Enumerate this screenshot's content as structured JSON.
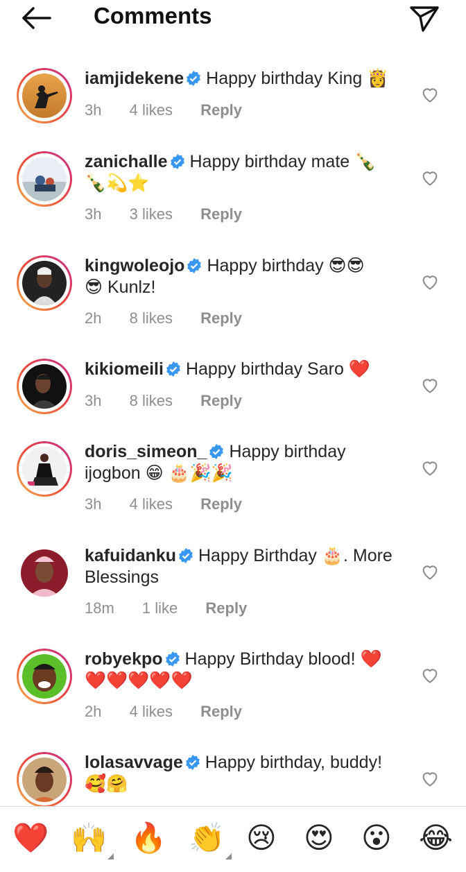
{
  "header": {
    "title": "Comments",
    "back_icon": "arrow-left-icon",
    "send_icon": "paper-plane-icon"
  },
  "comments": [
    {
      "username": "iamjidekene",
      "verified": true,
      "text": "Happy birthday King 👸",
      "extra": "",
      "time": "3h",
      "likes": "4 likes",
      "reply": "Reply",
      "story_ring": true
    },
    {
      "username": "zanichalle",
      "verified": true,
      "text": "Happy birthday mate 🍾",
      "extra": "🍾💫⭐",
      "time": "3h",
      "likes": "3 likes",
      "reply": "Reply",
      "story_ring": true
    },
    {
      "username": "kingwoleojo",
      "verified": true,
      "text": "Happy birthday 😎😎",
      "extra": "😎 Kunlz!",
      "time": "2h",
      "likes": "8 likes",
      "reply": "Reply",
      "story_ring": true
    },
    {
      "username": "kikiomeili",
      "verified": true,
      "text": "Happy birthday Saro ❤️",
      "extra": "",
      "time": "3h",
      "likes": "8 likes",
      "reply": "Reply",
      "story_ring": true
    },
    {
      "username": "doris_simeon_",
      "verified": true,
      "text": "Happy birthday",
      "extra": "ijogbon 😁 🎂🎉🎉",
      "time": "3h",
      "likes": "4 likes",
      "reply": "Reply",
      "story_ring": true
    },
    {
      "username": "kafuidanku",
      "verified": true,
      "text": "Happy Birthday 🎂. More",
      "extra": "Blessings",
      "time": "18m",
      "likes": "1 like",
      "reply": "Reply",
      "story_ring": false
    },
    {
      "username": "robyekpo",
      "verified": true,
      "text": "Happy Birthday blood! ❤️",
      "extra": "❤️❤️❤️❤️❤️",
      "time": "2h",
      "likes": "4 likes",
      "reply": "Reply",
      "story_ring": true
    },
    {
      "username": "lolasavvage",
      "verified": true,
      "text": "Happy birthday, buddy!",
      "extra": "🥰🤗",
      "time": "",
      "likes": "",
      "reply": "",
      "story_ring": true
    }
  ],
  "emoji_bar": [
    "❤️",
    "🙌",
    "🔥",
    "👏",
    "😢",
    "😍",
    "😮",
    "😂"
  ],
  "colors": {
    "verified": "#3897f0",
    "meta": "#8e8e8e",
    "text": "#262626"
  }
}
